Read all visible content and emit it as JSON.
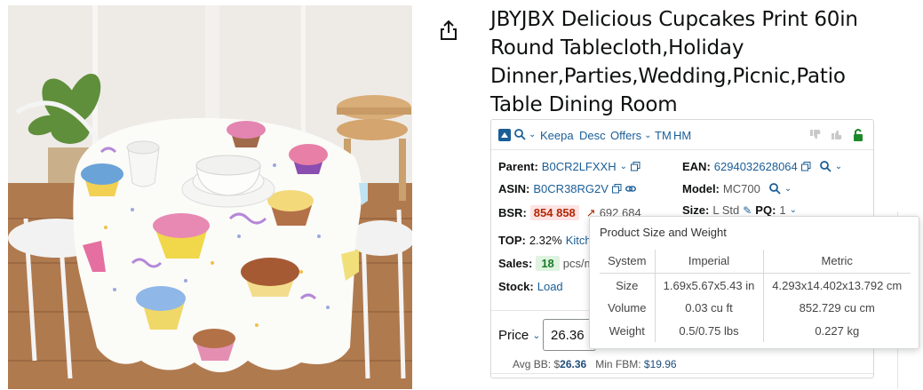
{
  "product": {
    "title": "JBYJBX Delicious Cupcakes Print 60in Round Tablecloth,Holiday Dinner,Parties,Wedding,Picnic,Patio Table Dining Room",
    "image_alt": "Round white tablecloth with colorful cupcake print on a dining table"
  },
  "share": {
    "icon": "share-icon"
  },
  "keepa": {
    "toolbar": {
      "keepa_label": "Keepa",
      "desc_label": "Desc",
      "offers_label": "Offers",
      "tm_label": "TM",
      "hm_label": "HM",
      "icons": [
        "keepa-logo-icon",
        "search-icon",
        "thumbs-down-icon",
        "thumbs-up-icon",
        "unlock-icon"
      ]
    },
    "parent_label": "Parent:",
    "parent_value": "B0CR2LFXXH",
    "ean_label": "EAN:",
    "ean_value": "6294032628064",
    "asin_label": "ASIN:",
    "asin_value": "B0CR38RG2V",
    "model_label": "Model:",
    "model_value": "MC700",
    "bsr_label": "BSR:",
    "bsr_value": "854 858",
    "bsr_prev": "692 684",
    "size_label": "Size:",
    "size_value": "L Std",
    "pq_label": "PQ:",
    "pq_value": "1",
    "top_label": "TOP:",
    "top_value": "2.32%",
    "top_link": "Kitch",
    "sales_label": "Sales:",
    "sales_value": "18",
    "sales_unit": "pcs/m",
    "stock_label": "Stock:",
    "stock_link": "Load",
    "price_label": "Price",
    "price_value": "26.36",
    "avg_bb_label": "Avg BB:",
    "avg_bb_currency": "$",
    "avg_bb_value": "26.36",
    "min_fbm_label": "Min FBM:",
    "min_fbm_value": "$19.96"
  },
  "popover": {
    "title": "Product Size and Weight",
    "columns": [
      "System",
      "Imperial",
      "Metric"
    ],
    "rows": [
      {
        "system": "Size",
        "imperial": "1.69x5.67x5.43 in",
        "metric": "4.293x14.402x13.792 cm"
      },
      {
        "system": "Volume",
        "imperial": "0.03 cu ft",
        "metric": "852.729 cu cm"
      },
      {
        "system": "Weight",
        "imperial": "0.5/0.75 lbs",
        "metric": "0.227 kg"
      }
    ]
  },
  "colors": {
    "link": "#1a5e97",
    "bsr_bg": "#fde3e3",
    "bsr_text": "#b12704",
    "sales_bg": "#dff3e0",
    "unlock": "#1d8a2a"
  }
}
